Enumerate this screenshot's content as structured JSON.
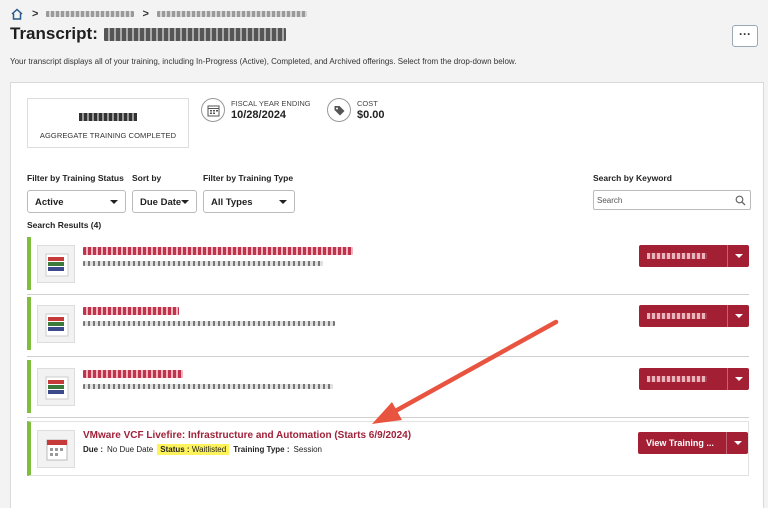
{
  "page": {
    "title_prefix": "Transcript:",
    "intro": "Your transcript displays all of your training, including In-Progress (Active), Completed, and Archived offerings. Select from the drop-down below.",
    "more_label": "···"
  },
  "summary": {
    "aggregate_label": "AGGREGATE TRAINING COMPLETED",
    "fiscal_label": "FISCAL YEAR ENDING",
    "fiscal_value": "10/28/2024",
    "cost_label": "COST",
    "cost_value": "$0.00"
  },
  "filters": {
    "status_label": "Filter by Training Status",
    "status_value": "Active",
    "sort_label": "Sort by",
    "sort_value": "Due Date",
    "type_label": "Filter by Training Type",
    "type_value": "All Types",
    "keyword_label": "Search by Keyword",
    "keyword_placeholder": "Search"
  },
  "results": {
    "label": "Search Results (4)",
    "featured": {
      "title": "VMware VCF Livefire: Infrastructure and Automation (Starts 6/9/2024)",
      "due_key": "Due :",
      "due_value": "No Due Date",
      "status_key": "Status :",
      "status_value": "Waitlisted",
      "type_key": "Training Type :",
      "type_value": "Session",
      "action_label": "View Training ..."
    }
  },
  "colors": {
    "accent": "#a31f34",
    "row_status": "#7fbe3d",
    "highlight": "#fff35c",
    "arrow": "#e8543f"
  },
  "icons": [
    "home-icon",
    "calendar-icon",
    "tag-icon",
    "search-icon",
    "training-thumbnail-icon",
    "chevron-down-icon"
  ]
}
